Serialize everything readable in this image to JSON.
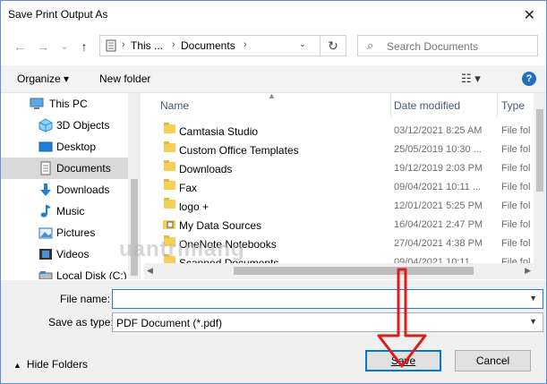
{
  "window": {
    "title": "Save Print Output As",
    "close_glyph": "✕"
  },
  "nav": {
    "back_glyph": "←",
    "forward_glyph": "→",
    "recent_glyph": "⌄",
    "up_glyph": "↑",
    "address": {
      "seg1": "This ...",
      "seg2": "Documents",
      "sep": "›",
      "refresh_glyph": "↻"
    },
    "search": {
      "placeholder": "Search Documents",
      "glyph": "⌕"
    }
  },
  "toolbar": {
    "organize": "Organize ▾",
    "new_folder": "New folder",
    "view_glyph": "☷ ▾",
    "help_glyph": "?"
  },
  "sidebar": {
    "items": [
      {
        "label": "This PC",
        "icon": "computer-icon"
      },
      {
        "label": "3D Objects",
        "icon": "cube-icon"
      },
      {
        "label": "Desktop",
        "icon": "desktop-icon"
      },
      {
        "label": "Documents",
        "icon": "document-icon"
      },
      {
        "label": "Downloads",
        "icon": "download-icon"
      },
      {
        "label": "Music",
        "icon": "music-icon"
      },
      {
        "label": "Pictures",
        "icon": "pictures-icon"
      },
      {
        "label": "Videos",
        "icon": "video-icon"
      },
      {
        "label": "Local Disk (C:)",
        "icon": "disk-icon"
      }
    ]
  },
  "list": {
    "columns": {
      "name": "Name",
      "date": "Date modified",
      "type": "Type"
    },
    "rows": [
      {
        "name": "Camtasia Studio",
        "date": "03/12/2021 8:25 AM",
        "type": "File fol"
      },
      {
        "name": "Custom Office Templates",
        "date": "25/05/2019 10:30 ...",
        "type": "File fol"
      },
      {
        "name": "Downloads",
        "date": "19/12/2019 2:03 PM",
        "type": "File fol"
      },
      {
        "name": "Fax",
        "date": "09/04/2021 10:11 ...",
        "type": "File fol"
      },
      {
        "name": "logo +",
        "date": "12/01/2021 5:25 PM",
        "type": "File fol"
      },
      {
        "name": "My Data Sources",
        "date": "16/04/2021 2:47 PM",
        "type": "File fol"
      },
      {
        "name": "OneNote Notebooks",
        "date": "27/04/2021 4:38 PM",
        "type": "File fol"
      },
      {
        "name": "Scanned Documents",
        "date": "09/04/2021 10:11 ...",
        "type": "File fol"
      }
    ]
  },
  "form": {
    "file_name_label": "File name:",
    "file_name_value": "",
    "save_type_label": "Save as type:",
    "save_type_value": "PDF Document (*.pdf)"
  },
  "footer": {
    "hide_folders": "Hide Folders",
    "save": "Save",
    "cancel": "Cancel"
  },
  "watermark": {
    "text": "uantrimang"
  },
  "colors": {
    "accent": "#0078d7",
    "arrow": "#e01b1b",
    "folder": "#f6cf57"
  }
}
